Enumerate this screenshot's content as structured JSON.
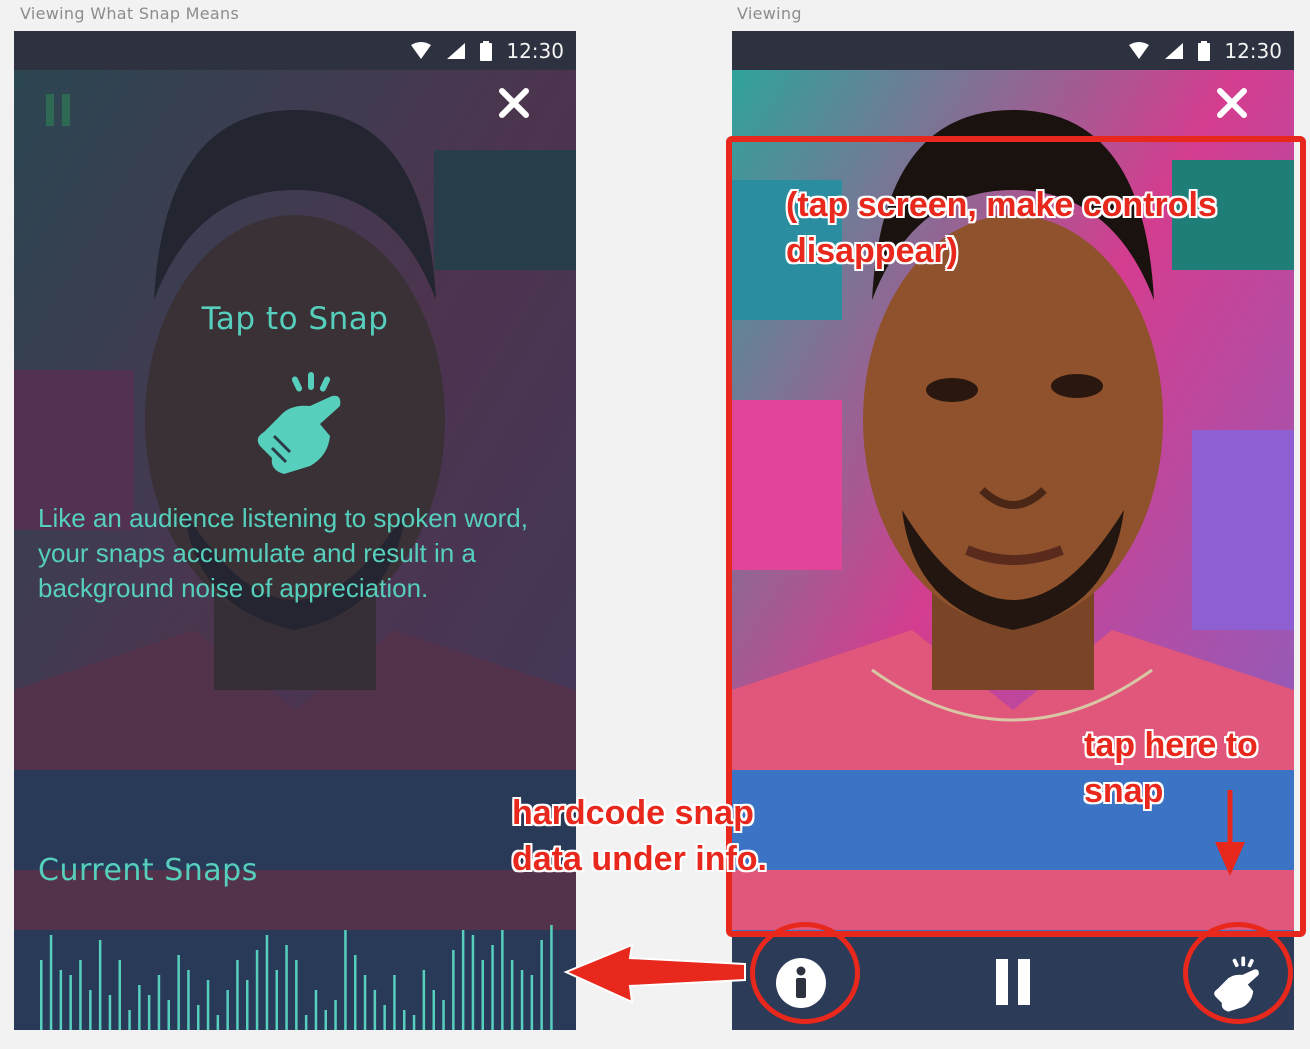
{
  "left_screen": {
    "frame_label": "Viewing What Snap Means",
    "status_time": "12:30",
    "title": "Tap to Snap",
    "description_lines": [
      "Like an audience listening to spoken word,",
      "your snaps accumulate and result in a",
      "background noise of appreciation."
    ],
    "current_snaps_label": "Current Snaps",
    "icons": [
      "pause-icon",
      "close-icon",
      "snap-hand-icon",
      "wifi-icon",
      "signal-icon",
      "battery-icon"
    ]
  },
  "right_screen": {
    "frame_label": "Viewing",
    "status_time": "12:30",
    "icons": [
      "close-icon",
      "info-icon",
      "pause-icon",
      "snap-hand-icon"
    ]
  },
  "annotations": {
    "tap_screen": [
      "(tap screen, make controls",
      "disappear)"
    ],
    "tap_here": [
      "tap here to",
      "snap"
    ],
    "hardcode": [
      "hardcode snap",
      "data under info."
    ]
  },
  "colors": {
    "accent_teal": "#56cfbd",
    "annotation_red": "#e8281c",
    "bar_dark": "#2d3140"
  }
}
